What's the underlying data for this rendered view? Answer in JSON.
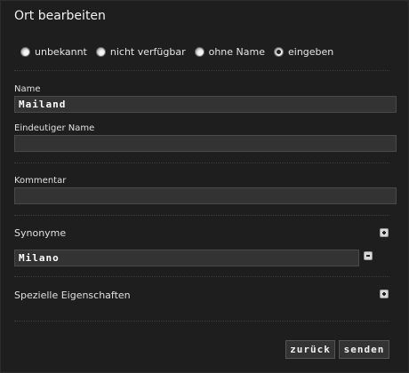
{
  "dialog": {
    "title": "Ort bearbeiten"
  },
  "name_mode": {
    "options": [
      {
        "label": "unbekannt",
        "checked": false
      },
      {
        "label": "nicht verfügbar",
        "checked": false
      },
      {
        "label": "ohne Name",
        "checked": false
      },
      {
        "label": "eingeben",
        "checked": true
      }
    ]
  },
  "fields": {
    "name_label": "Name",
    "name_value": "Mailand",
    "unique_name_label": "Eindeutiger Name",
    "unique_name_value": "",
    "comment_label": "Kommentar",
    "comment_value": ""
  },
  "synonyms": {
    "label": "Synonyme",
    "items": [
      "Milano"
    ]
  },
  "properties": {
    "label": "Spezielle Eigenschaften"
  },
  "buttons": {
    "back": "zurück",
    "send": "senden"
  }
}
